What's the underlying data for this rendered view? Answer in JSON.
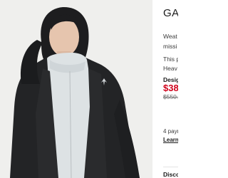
{
  "product": {
    "title": "GA",
    "description_lines": [
      "Weat",
      "missi",
      "This p",
      "Heav"
    ],
    "design_link": "Desig",
    "sale_price": "$38",
    "original_price": "$550.",
    "payments_text": "4 payn",
    "learn_link": "Learn",
    "discover_label": "Disco"
  },
  "image": {
    "background_color": "#efefed",
    "jacket_color": "#232426",
    "fleece_color": "#dde2e4",
    "logo_icon": "arcteryx-bird-logo-icon"
  },
  "colors": {
    "sale_red": "#d0021b",
    "text": "#1a1a1a"
  }
}
